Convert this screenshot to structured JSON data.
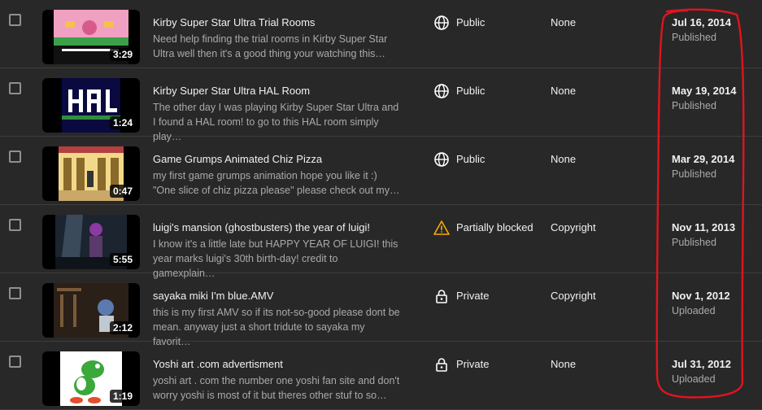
{
  "videos": [
    {
      "title": "Kirby Super Star Ultra Trial Rooms",
      "description": "Need help finding the trial rooms in Kirby Super Star Ultra well then it's a good thing your watching this…",
      "duration": "3:29",
      "visibility": "Public",
      "visibility_icon": "globe-icon",
      "restrictions": "None",
      "date": "Jul 16, 2014",
      "status": "Published",
      "thumb_colors": [
        "#d85a8c",
        "#3aa14a",
        "#f5c14a"
      ]
    },
    {
      "title": "Kirby Super Star Ultra HAL Room",
      "description": "The other day I was playing Kirby Super Star Ultra and I found a HAL room! to go to this HAL room simply play…",
      "duration": "1:24",
      "visibility": "Public",
      "visibility_icon": "globe-icon",
      "restrictions": "None",
      "date": "May 19, 2014",
      "status": "Published",
      "thumb_colors": [
        "#0a0a40",
        "#ffffff",
        "#2f8f3a"
      ]
    },
    {
      "title": "Game Grumps Animated Chiz Pizza",
      "description": "my first game grumps animation hope you like it :) \"One slice of chiz pizza please\" please check out my…",
      "duration": "0:47",
      "visibility": "Public",
      "visibility_icon": "globe-icon",
      "restrictions": "None",
      "date": "Mar 29, 2014",
      "status": "Published",
      "thumb_colors": [
        "#f2d98a",
        "#b34040",
        "#8a6a2a"
      ]
    },
    {
      "title": "luigi's mansion (ghostbusters) the year of luigi!",
      "description": "I know it's a little late but HAPPY YEAR OF LUIGI! this year marks luigi's 30th birth-day! credit to gamexplain…",
      "duration": "5:55",
      "visibility": "Partially blocked",
      "visibility_icon": "warning-icon",
      "restrictions": "Copyright",
      "date": "Nov 11, 2013",
      "status": "Published",
      "thumb_colors": [
        "#1c2430",
        "#5a3a6a",
        "#3a4a5a"
      ]
    },
    {
      "title": "sayaka miki I'm blue.AMV",
      "description": "this is my first AMV so if its not-so-good please dont be mean. anyway just a short tridute to sayaka my favorit…",
      "duration": "2:12",
      "visibility": "Private",
      "visibility_icon": "lock-icon",
      "restrictions": "Copyright",
      "date": "Nov 1, 2012",
      "status": "Uploaded",
      "thumb_colors": [
        "#2a2018",
        "#7a5a3a",
        "#c0c8d0"
      ]
    },
    {
      "title": "Yoshi art .com advertisment",
      "description": "yoshi art . com the number one yoshi fan site and don't worry yoshi is most of it but theres other stuf to so…",
      "duration": "1:19",
      "visibility": "Private",
      "visibility_icon": "lock-icon",
      "restrictions": "None",
      "date": "Jul 31, 2012",
      "status": "Uploaded",
      "thumb_colors": [
        "#ffffff",
        "#3aa83a",
        "#e05030"
      ]
    }
  ],
  "annotation": {
    "color": "#e0141e"
  }
}
